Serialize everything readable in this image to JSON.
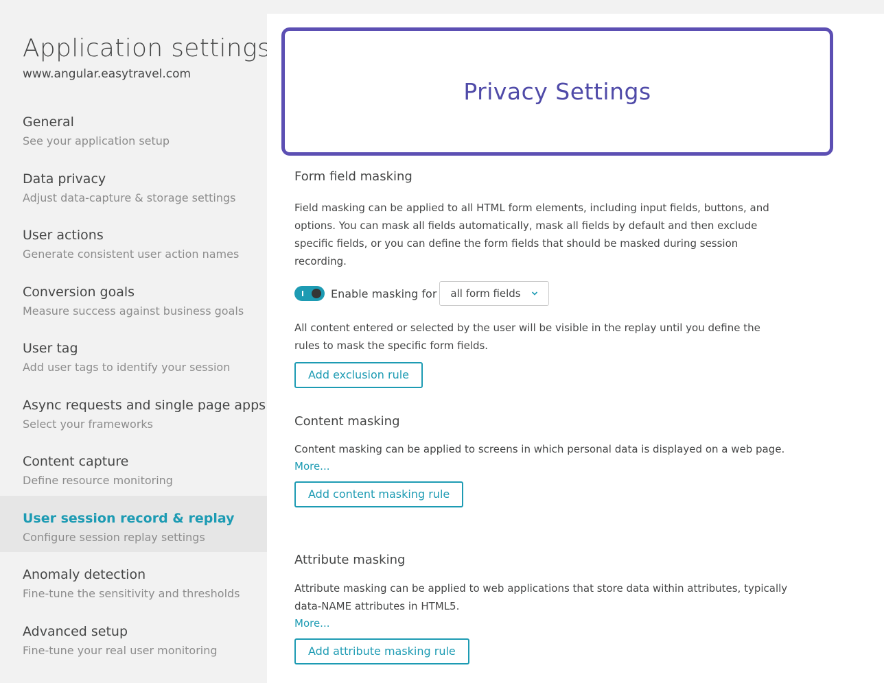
{
  "sidebar": {
    "title": "Application settings",
    "url": "www.angular.easytravel.com",
    "items": [
      {
        "title": "General",
        "subtitle": "See your application setup"
      },
      {
        "title": "Data privacy",
        "subtitle": "Adjust data-capture & storage settings"
      },
      {
        "title": "User actions",
        "subtitle": "Generate consistent user action names"
      },
      {
        "title": "Conversion goals",
        "subtitle": "Measure success against business goals"
      },
      {
        "title": "User tag",
        "subtitle": "Add user tags to identify your session"
      },
      {
        "title": "Async requests and single page apps",
        "subtitle": "Select your frameworks"
      },
      {
        "title": "Content capture",
        "subtitle": "Define resource monitoring"
      },
      {
        "title": "User session record & replay",
        "subtitle": "Configure session replay settings",
        "active": true
      },
      {
        "title": "Anomaly detection",
        "subtitle": "Fine-tune the sensitivity and thresholds"
      },
      {
        "title": "Advanced setup",
        "subtitle": "Fine-tune your real user monitoring"
      }
    ]
  },
  "callout": {
    "title": "Privacy Settings"
  },
  "form_field_masking": {
    "title": "Form field masking",
    "description": "Field masking can be applied to all HTML form elements, including input fields, buttons, and options. You can mask all fields automatically, mask all fields by default and then exclude specific fields, or you can define the form fields that should be masked during session recording.",
    "toggle_label": "Enable masking for",
    "select_value": "all form fields",
    "note": "All content entered or selected by the user will be visible in the replay until you define the rules to mask the specific form fields.",
    "button_label": "Add exclusion rule"
  },
  "content_masking": {
    "title": "Content masking",
    "description": "Content masking can be applied to screens in which personal data is displayed on a web page.",
    "more_label": "More...",
    "button_label": "Add content masking rule"
  },
  "attribute_masking": {
    "title": "Attribute masking",
    "description": "Attribute masking can be applied to web applications that store data within attributes, typically data-NAME attributes in HTML5.",
    "more_label": "More...",
    "button_label": "Add attribute masking rule"
  },
  "colors": {
    "accent": "#1d9bb3",
    "callout_border": "#5c4fb3",
    "callout_text": "#4f4aa8",
    "sidebar_bg": "#f2f2f2",
    "active_item_bg": "#e6e6e6"
  },
  "icons": {
    "toggle": "toggle-on-icon",
    "select": "chevron-down-icon"
  }
}
